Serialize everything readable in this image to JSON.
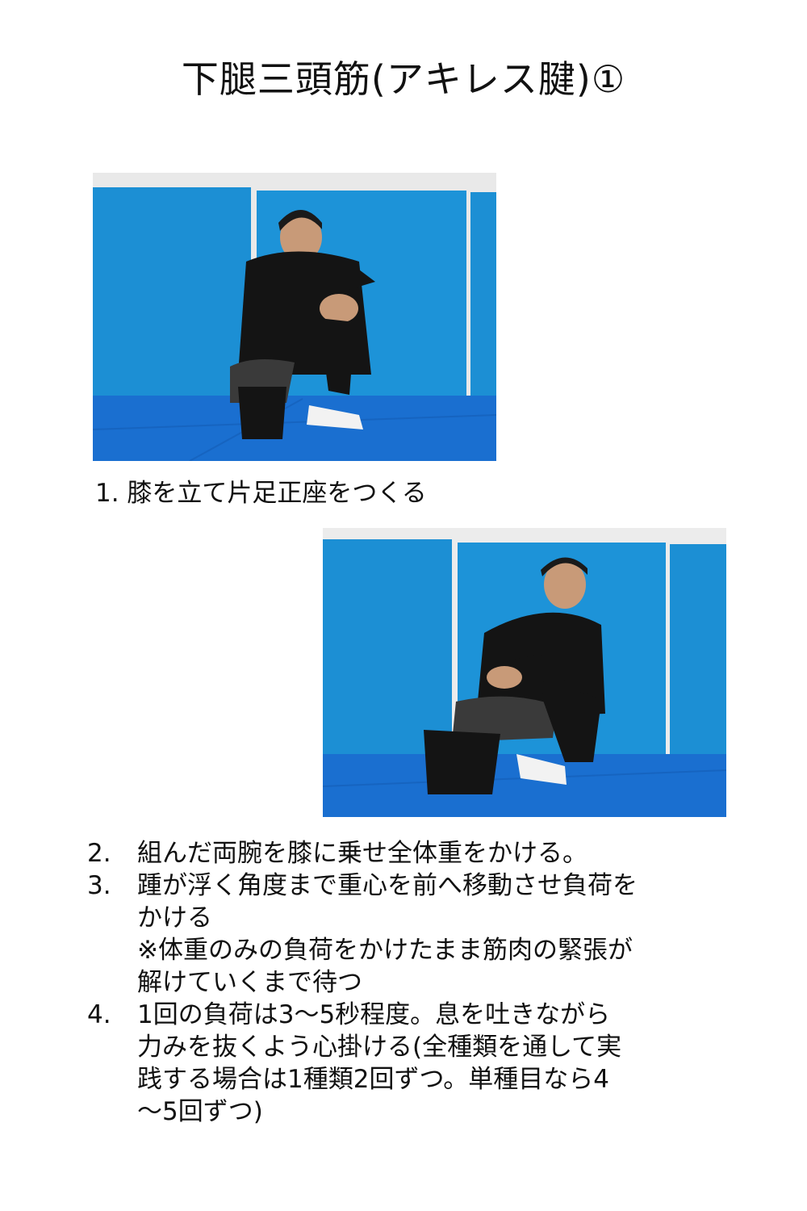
{
  "title": "下腿三頭筋(アキレス腱)①",
  "colors": {
    "mat_blue": "#1c8fd4",
    "floor_blue": "#1a6fd0",
    "shirt": "#141414",
    "skin": "#c89a78"
  },
  "photo1": {
    "alt": "photo-kneeling-one-knee-up"
  },
  "caption1": "1. 膝を立て片足正座をつくる",
  "photo2": {
    "alt": "photo-leaning-forward-on-knee"
  },
  "steps": [
    {
      "num": "2.",
      "lines": [
        "組んだ両腕を膝に乗せ全体重をかける。"
      ]
    },
    {
      "num": "3.",
      "lines": [
        "踵が浮く角度まで重心を前へ移動させ負荷を",
        "かける",
        "※体重のみの負荷をかけたまま筋肉の緊張が",
        "解けていくまで待つ"
      ]
    },
    {
      "num": "4.",
      "lines": [
        "1回の負荷は3〜5秒程度。息を吐きながら",
        "力みを抜くよう心掛ける(全種類を通して実",
        "践する場合は1種類2回ずつ。単種目なら4",
        "〜5回ずつ)"
      ]
    }
  ]
}
